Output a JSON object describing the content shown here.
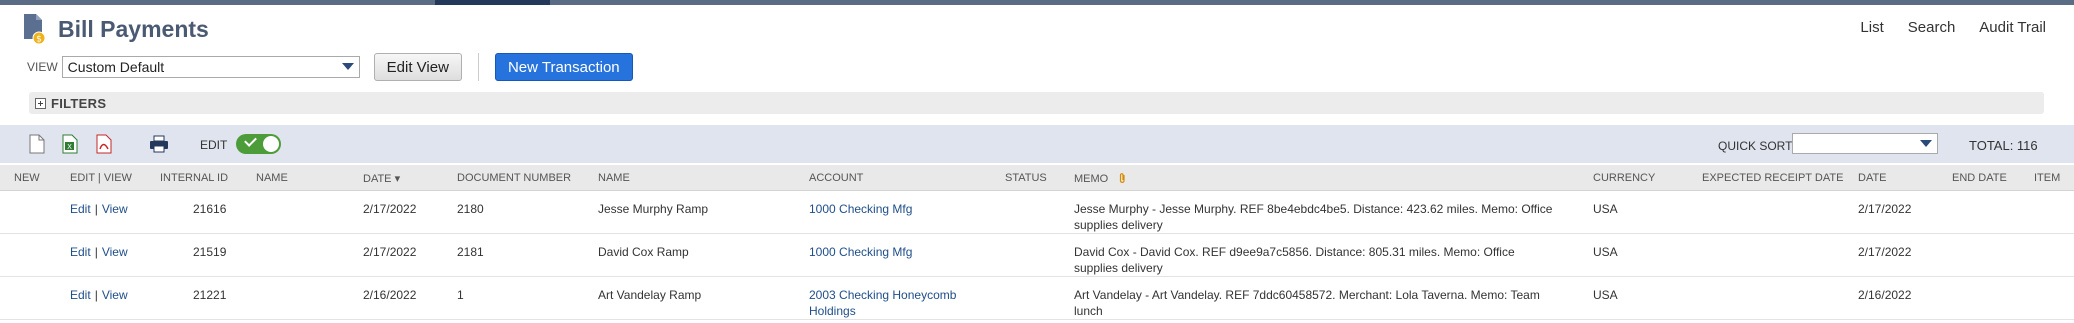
{
  "header": {
    "title": "Bill Payments",
    "links": [
      "List",
      "Search",
      "Audit Trail"
    ]
  },
  "view": {
    "label": "VIEW",
    "selected": "Custom Default",
    "edit_view": "Edit View",
    "new_transaction": "New Transaction"
  },
  "filters": {
    "label": "FILTERS"
  },
  "toolbar": {
    "edit_label": "EDIT",
    "edit_on": true,
    "quick_sort_label": "QUICK SORT",
    "quick_sort_value": "",
    "total": "TOTAL: 116"
  },
  "columns": {
    "new": "NEW",
    "edit_view": "EDIT | VIEW",
    "internal_id": "INTERNAL ID",
    "name": "NAME",
    "date": "DATE ▾",
    "doc_number": "DOCUMENT NUMBER",
    "payee": "NAME",
    "account": "ACCOUNT",
    "status": "STATUS",
    "memo": "MEMO",
    "currency": "CURRENCY",
    "expected_receipt": "EXPECTED RECEIPT DATE",
    "date2": "DATE",
    "end_date": "END DATE",
    "item": "ITEM"
  },
  "row_actions": {
    "edit": "Edit",
    "view": "View",
    "separator": "|"
  },
  "rows": [
    {
      "internal_id": "21616",
      "date": "2/17/2022",
      "doc_number": "2180",
      "payee": "Jesse Murphy Ramp",
      "account": "1000 Checking Mfg",
      "account2": "",
      "memo": "Jesse Murphy - Jesse Murphy. REF 8be4ebdc4be5. Distance: 423.62 miles. Memo: Office",
      "memo2": "supplies delivery",
      "currency": "USA",
      "date2": "2/17/2022"
    },
    {
      "internal_id": "21519",
      "date": "2/17/2022",
      "doc_number": "2181",
      "payee": "David Cox Ramp",
      "account": "1000 Checking Mfg",
      "account2": "",
      "memo": "David Cox - David Cox. REF d9ee9a7c5856. Distance: 805.31 miles. Memo: Office",
      "memo2": "supplies delivery",
      "currency": "USA",
      "date2": "2/17/2022"
    },
    {
      "internal_id": "21221",
      "date": "2/16/2022",
      "doc_number": "1",
      "payee": "Art Vandelay Ramp",
      "account": "2003 Checking Honeycomb",
      "account2": "Holdings",
      "memo": "Art Vandelay - Art Vandelay. REF 7ddc60458572. Merchant: Lola Taverna. Memo: Team",
      "memo2": "lunch",
      "currency": "USA",
      "date2": "2/16/2022"
    }
  ]
}
